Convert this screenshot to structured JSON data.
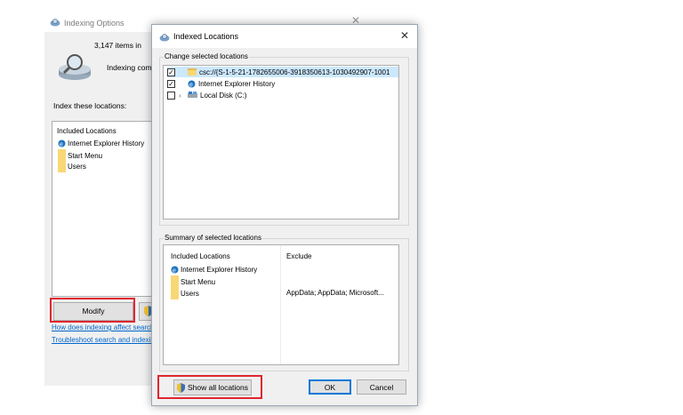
{
  "indexing_options": {
    "title": "Indexing Options",
    "items_count": "3,147 items in",
    "status": "Indexing comp",
    "index_label": "Index these locations:",
    "list_header": "Included Locations",
    "items": [
      "Internet Explorer History",
      "Start Menu",
      "Users"
    ],
    "modify_label": "Modify",
    "link_help": "How does indexing affect search",
    "link_troubleshoot": "Troubleshoot search and indexing"
  },
  "dialog": {
    "title": "Indexed Locations",
    "change_group": "Change selected locations",
    "tree": [
      {
        "label": "csc://{S-1-5-21-1782655006-3918350613-1030492907-1001",
        "checked": true,
        "selected": true,
        "icon": "folder-icon"
      },
      {
        "label": "Internet Explorer History",
        "checked": true,
        "icon": "ie-icon"
      },
      {
        "label": "Local Disk (C:)",
        "checked": false,
        "expandable": true,
        "icon": "drive-icon"
      }
    ],
    "summary_group": "Summary of selected locations",
    "summary_headers": {
      "included": "Included Locations",
      "exclude": "Exclude"
    },
    "summary_rows": [
      {
        "included": "Internet Explorer History",
        "exclude": ""
      },
      {
        "included": "Start Menu",
        "exclude": ""
      },
      {
        "included": "Users",
        "exclude": "AppData; AppData; Microsoft..."
      }
    ],
    "buttons": {
      "show_all": "Show all locations",
      "ok": "OK",
      "cancel": "Cancel"
    }
  },
  "colors": {
    "highlight": "#e0262e",
    "selection": "#cce8ff",
    "accent": "#0078d7",
    "link": "#0066cc"
  }
}
